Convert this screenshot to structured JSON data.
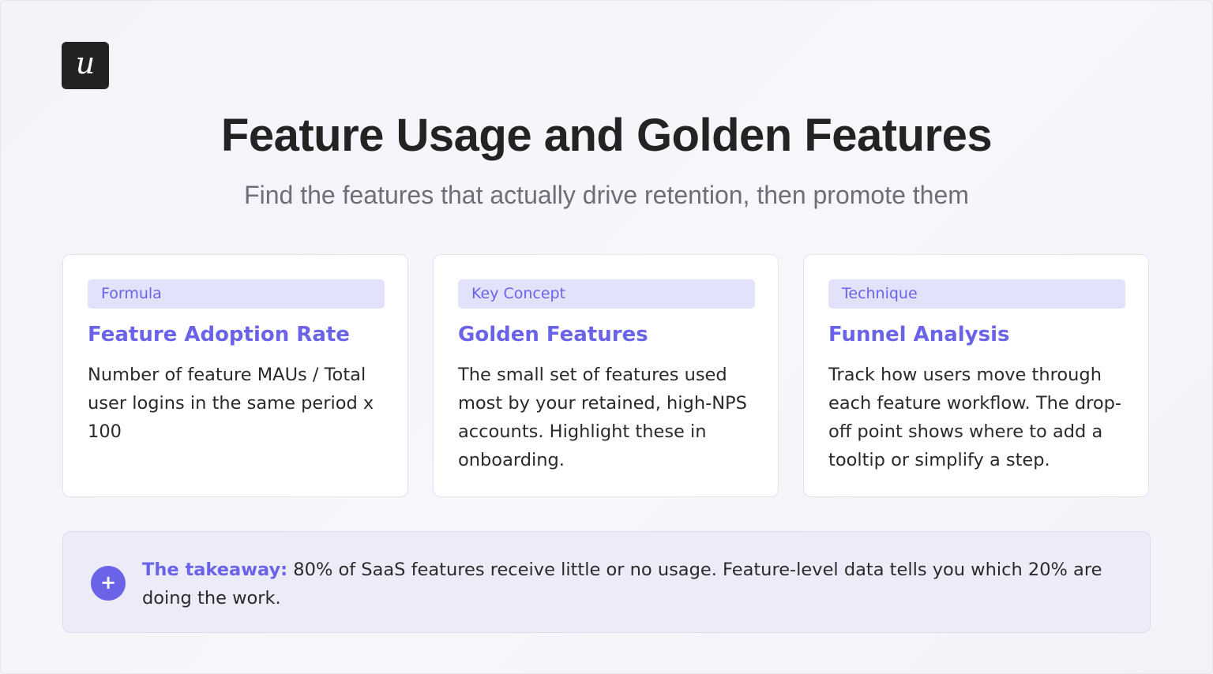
{
  "brand": {
    "logo_letter": "u",
    "accent_color": "#6a63e8",
    "badge_color": "#e3e2fb",
    "dark_color": "#232323"
  },
  "header": {
    "title": "Feature Usage and Golden Features",
    "subtitle": "Find the features that actually drive retention, then promote them"
  },
  "cards": [
    {
      "badge": "Formula",
      "title": "Feature Adoption Rate",
      "body": "Number of feature MAUs / Total user logins in the same period x 100"
    },
    {
      "badge": "Key Concept",
      "title": "Golden Features",
      "body": "The small set of features used most by your retained, high-NPS accounts. Highlight these in onboarding."
    },
    {
      "badge": "Technique",
      "title": "Funnel Analysis",
      "body": "Track how users move through each feature workflow. The drop-off point shows where to add a tooltip or simplify a step."
    }
  ],
  "takeaway": {
    "icon": "plus-icon",
    "symbol": "+",
    "label": "The takeaway:",
    "text": " 80% of SaaS features receive little or no usage. Feature-level data tells you which 20% are doing the work."
  }
}
